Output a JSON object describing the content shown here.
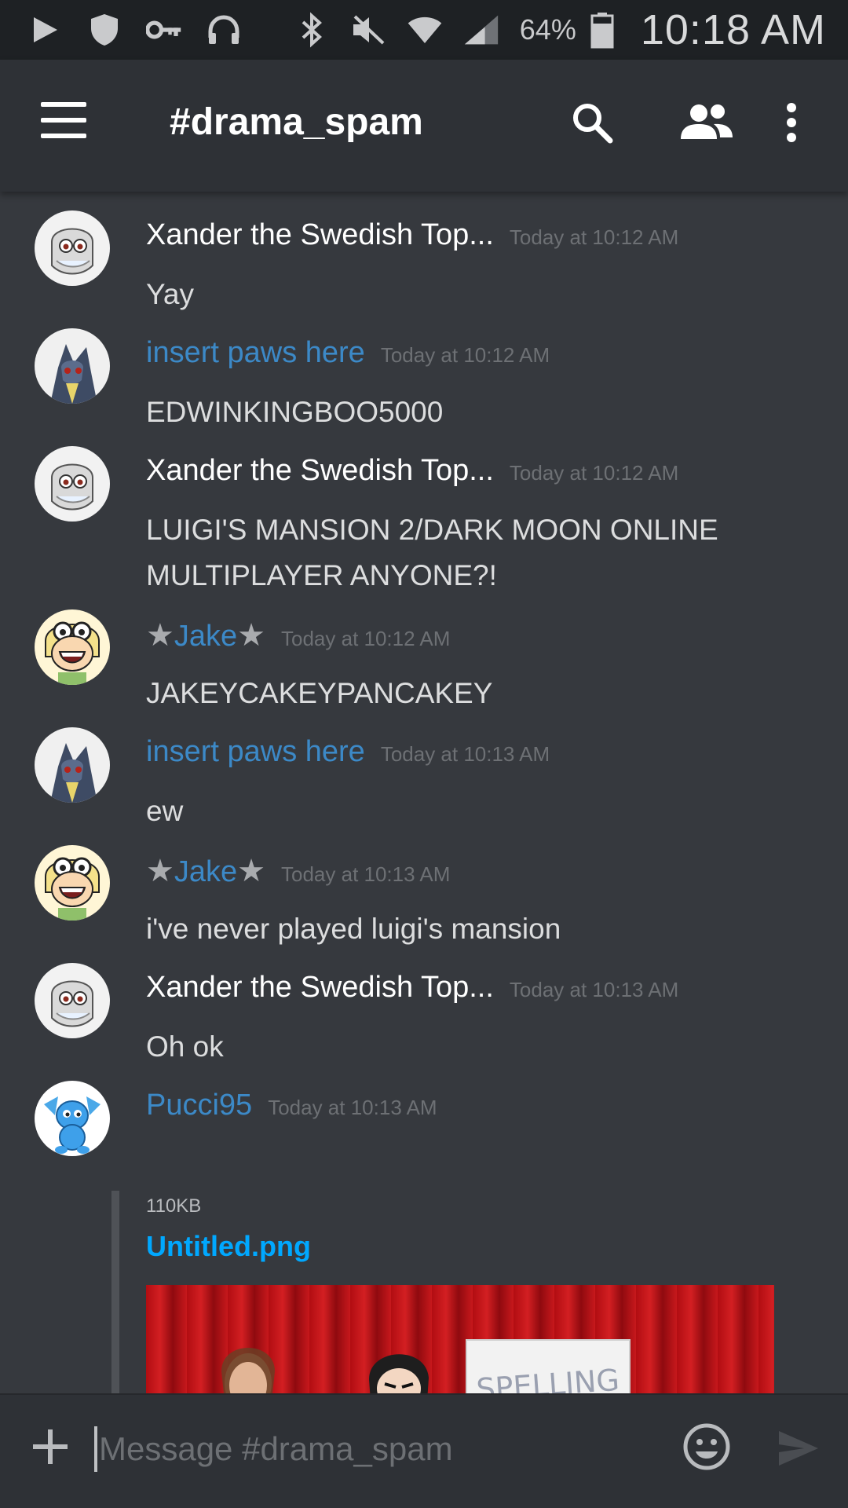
{
  "status_bar": {
    "battery_percent": "64%",
    "time": "10:18 AM",
    "left_icons": [
      "play-store-icon",
      "shield-icon",
      "vpn-key-icon",
      "headset-icon"
    ],
    "right_icons": [
      "bluetooth-icon",
      "mute-icon",
      "wifi-icon",
      "signal-icon",
      "battery-icon"
    ]
  },
  "header": {
    "channel": "#drama_spam",
    "icons": [
      "menu-icon",
      "search-icon",
      "members-icon",
      "more-vert-icon"
    ]
  },
  "messages": [
    {
      "author": "Xander the Swedish Top...",
      "time": "Today at 10:12 AM",
      "text": "Yay",
      "author_color": "#ffffff"
    },
    {
      "author": "insert paws here",
      "time": "Today at 10:12 AM",
      "text": "EDWINKINGBOO5000",
      "author_color": "#3c89c7"
    },
    {
      "author": "Xander the Swedish Top...",
      "time": "Today at 10:12 AM",
      "text": "LUIGI'S MANSION 2/DARK MOON ONLINE MULTIPLAYER ANYONE?!",
      "author_color": "#ffffff"
    },
    {
      "author": "Jake",
      "time": "Today at 10:12 AM",
      "text": "JAKEYCAKEYPANCAKEY",
      "author_color": "#3c89c7"
    },
    {
      "author": "insert paws here",
      "time": "Today at 10:13 AM",
      "text": "ew",
      "author_color": "#3c89c7"
    },
    {
      "author": "Jake",
      "time": "Today at 10:13 AM",
      "text": "i've never played luigi's mansion",
      "author_color": "#3c89c7"
    },
    {
      "author": "Xander the Swedish Top...",
      "time": "Today at 10:13 AM",
      "text": "Oh ok",
      "author_color": "#ffffff"
    },
    {
      "author": "Pucci95",
      "time": "Today at 10:13 AM",
      "text": "",
      "author_color": "#3c89c7"
    }
  ],
  "attachment": {
    "size": "110KB",
    "filename": "Untitled.png",
    "sign_text": "SPELLING"
  },
  "composer": {
    "placeholder": "Message #drama_spam"
  },
  "colors": {
    "background": "#36393e",
    "header": "#2e3136",
    "status_bar": "#1e2124",
    "link": "#00a8ff",
    "author_blue": "#3c89c7"
  }
}
